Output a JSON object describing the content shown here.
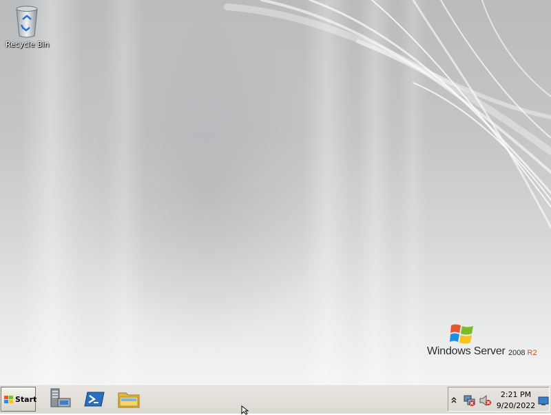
{
  "desktop": {
    "icons": [
      {
        "label": "Recycle Bin",
        "icon": "recycle-bin-icon"
      }
    ],
    "branding": {
      "product": "Windows Server",
      "version": "2008",
      "edition": "R2",
      "accent": "#d2501e"
    }
  },
  "taskbar": {
    "start_label": "Start",
    "pinned": [
      {
        "name": "server-manager",
        "icon": "server-manager-icon"
      },
      {
        "name": "powershell",
        "icon": "powershell-icon"
      },
      {
        "name": "windows-explorer",
        "icon": "folder-icon"
      }
    ],
    "tray": {
      "icons": [
        "show-hidden-icons-chevron",
        "network-disconnected-icon",
        "volume-muted-icon"
      ],
      "time": "2:21 PM",
      "date": "9/20/2022"
    }
  }
}
